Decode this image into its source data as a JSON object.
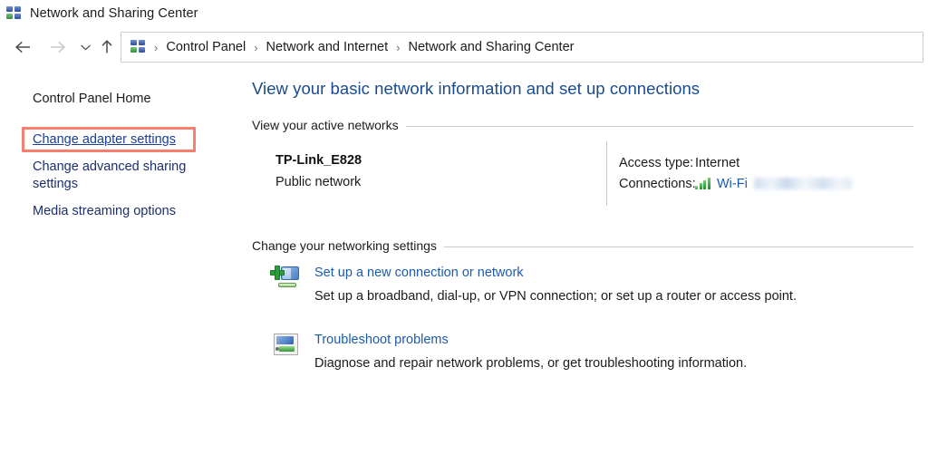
{
  "window": {
    "title": "Network and Sharing Center",
    "icon": "network-sharing-icon"
  },
  "navigation": {
    "back_icon": "arrow-left-icon",
    "forward_icon": "arrow-right-icon",
    "recent_icon": "chevron-down-icon",
    "up_icon": "arrow-up-icon",
    "address_icon": "network-sharing-icon",
    "breadcrumb": [
      "Control Panel",
      "Network and Internet",
      "Network and Sharing Center"
    ],
    "separator": "›"
  },
  "sidebar": {
    "items": [
      {
        "label": "Control Panel Home",
        "link": false
      },
      {
        "label": "Change adapter settings",
        "link": true,
        "highlighted": true
      },
      {
        "label": "Change advanced sharing settings",
        "link": true
      },
      {
        "label": "Media streaming options",
        "link": true
      }
    ],
    "highlight_color": "#f4634f"
  },
  "main": {
    "heading": "View your basic network information and set up connections",
    "heading_color": "#1a4b8c",
    "sections": [
      {
        "label": "View your active networks"
      },
      {
        "label": "Change your networking settings"
      }
    ],
    "active_network": {
      "name": "TP-Link_E828",
      "type": "Public network",
      "details": [
        {
          "key": "Access type:",
          "value": "Internet"
        },
        {
          "key": "Connections:",
          "value": "Wi-Fi",
          "icon": "wifi-signal-bars-icon",
          "redacted": true
        }
      ]
    },
    "tasks": [
      {
        "icon": "new-connection-icon",
        "title": "Set up a new connection or network",
        "description": "Set up a broadband, dial-up, or VPN connection; or set up a router or access point."
      },
      {
        "icon": "troubleshoot-icon",
        "title": "Troubleshoot problems",
        "description": "Diagnose and repair network problems, or get troubleshooting information."
      }
    ],
    "link_color": "#1a5bb0"
  }
}
